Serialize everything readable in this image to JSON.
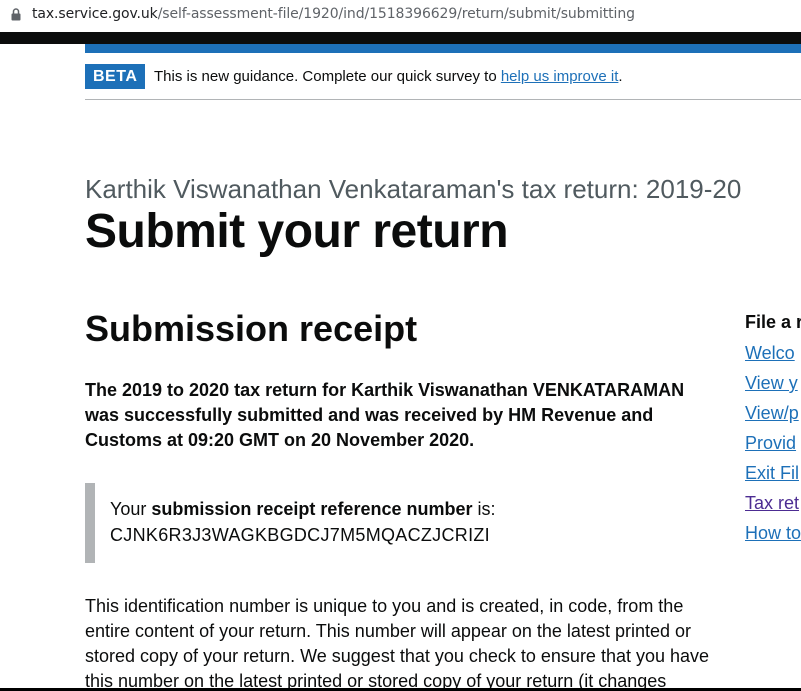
{
  "browser": {
    "url_host": "tax.service.gov.uk",
    "url_path": "/self-assessment-file/1920/ind/1518396629/return/submit/submitting"
  },
  "beta_banner": {
    "tag": "BETA",
    "message": "This is new guidance. Complete our quick survey to ",
    "link": "help us improve it",
    "suffix": "."
  },
  "caption": "Karthik Viswanathan Venkataraman's tax return:  2019-20",
  "heading": "Submit your return",
  "section_heading": "Submission receipt",
  "lead": "The 2019 to 2020 tax return for Karthik Viswanathan VENKATARAMAN was successfully submitted and was received by HM Revenue and Customs at 09:20 GMT on 20 November 2020.",
  "receipt": {
    "prefix": "Your ",
    "bold": "submission receipt reference number",
    "suffix": " is:",
    "reference": "CJNK6R3J3WAGKBGDCJ7M5MQACZJCRIZI"
  },
  "body_text": "This identification number is unique to you and is created, in code, from the entire content of your return. This number will appear on the latest printed or stored copy of your return. We suggest that you check to ensure that you have this number on the latest printed or stored copy of your return (it changes",
  "sidebar": {
    "title": "File a r",
    "links": [
      "Welco",
      "View y",
      "View/p",
      "Provid",
      "Exit Fil",
      "Tax ret",
      "How to"
    ]
  },
  "colors": {
    "link": "#1d70b8",
    "visited": "#4c2c92",
    "beta_tag": "#1d70b8",
    "inset_border": "#b1b4b6"
  }
}
